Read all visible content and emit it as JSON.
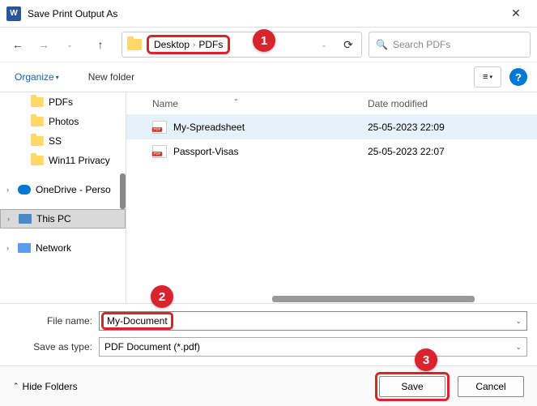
{
  "title": "Save Print Output As",
  "breadcrumbs": {
    "a": "Desktop",
    "b": "PDFs"
  },
  "search": {
    "placeholder": "Search PDFs"
  },
  "toolbar": {
    "organize": "Organize",
    "newfolder": "New folder"
  },
  "sidebar": {
    "items": [
      {
        "label": "PDFs"
      },
      {
        "label": "Photos"
      },
      {
        "label": "SS"
      },
      {
        "label": "Win11 Privacy"
      },
      {
        "label": "OneDrive - Perso"
      },
      {
        "label": "This PC"
      },
      {
        "label": "Network"
      }
    ]
  },
  "columns": {
    "name": "Name",
    "date": "Date modified"
  },
  "files": [
    {
      "name": "My-Spreadsheet",
      "date": "25-05-2023 22:09"
    },
    {
      "name": "Passport-Visas",
      "date": "25-05-2023 22:07"
    }
  ],
  "fields": {
    "filename_label": "File name:",
    "filename_value": "My-Document",
    "type_label": "Save as type:",
    "type_value": "PDF Document (*.pdf)"
  },
  "footer": {
    "hide": "Hide Folders",
    "save": "Save",
    "cancel": "Cancel"
  },
  "callouts": {
    "c1": "1",
    "c2": "2",
    "c3": "3"
  }
}
